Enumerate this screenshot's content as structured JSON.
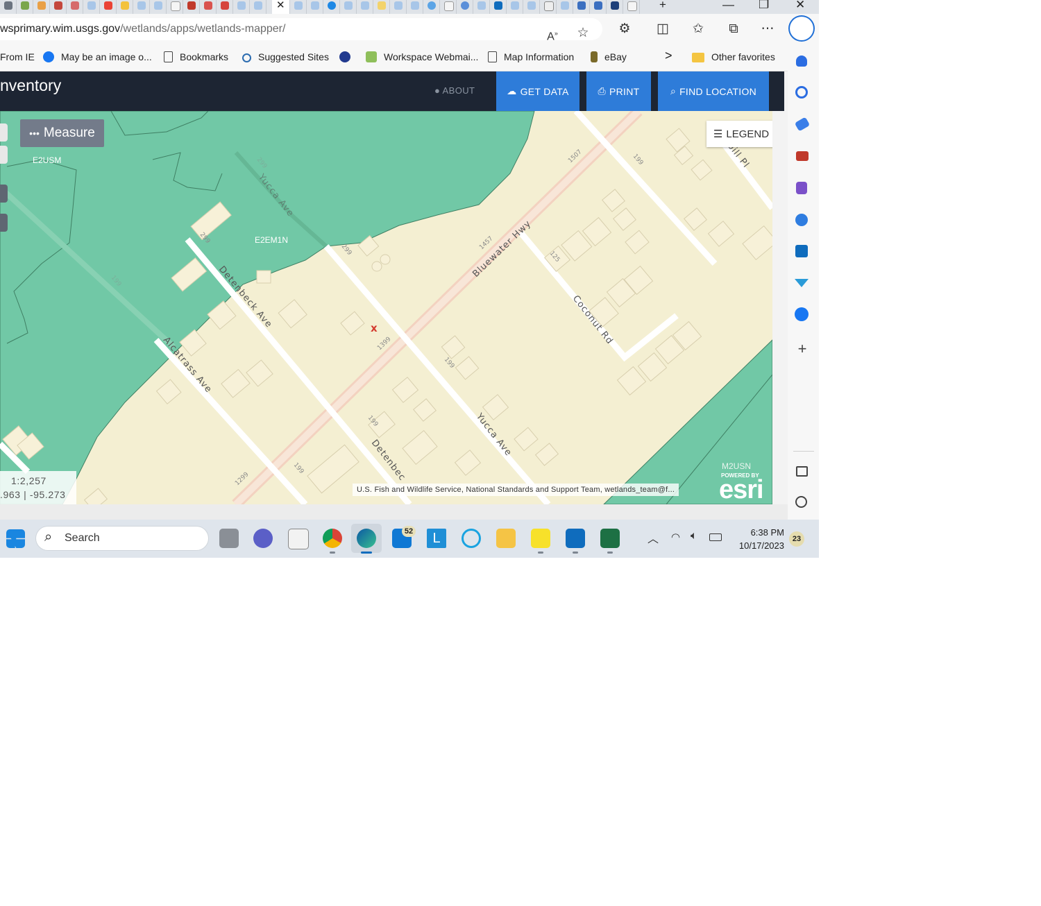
{
  "browser": {
    "url_host": "wsprimary.wim.usgs.gov",
    "url_path": "/wetlands/apps/wetlands-mapper/",
    "tab_close_glyph": "✕",
    "new_tab_glyph": "+",
    "window_controls": [
      "—",
      "❐",
      "✕"
    ]
  },
  "favorites": [
    {
      "label": "From IE",
      "icon": "none"
    },
    {
      "label": "May be an image o...",
      "icon": "facebook-icon"
    },
    {
      "label": "Bookmarks",
      "icon": "page-icon"
    },
    {
      "label": "Suggested Sites",
      "icon": "search-icon"
    },
    {
      "label": "Workspace Webmai...",
      "icon": "webmail-icon"
    },
    {
      "label": "Map Information",
      "icon": "page-icon"
    },
    {
      "label": "eBay",
      "icon": "ebay-icon"
    }
  ],
  "favorites_more": ">",
  "favorites_other": "Other favorites",
  "app": {
    "title": "nventory",
    "about": "ABOUT",
    "get_data": "GET DATA",
    "print": "PRINT",
    "find_location": "FIND LOCATION"
  },
  "map": {
    "measure": "Measure",
    "legend": "LEGEND",
    "scale": "1:2,257",
    "coords": ".963 | -95.273",
    "attribution": "U.S. Fish and Wildlife Service, National Standards and Support Team, wetlands_team@f...",
    "esri_powered": "POWERED BY",
    "esri_logo": "esri",
    "marker": "x",
    "labels": {
      "e2usm": "E2USM",
      "e2em1n": "E2EM1N",
      "m2usn": "M2USN"
    },
    "streets": {
      "yucca_upper": "Yucca Ave",
      "yucca_lower": "Yucca Ave",
      "bluewater": "Bluewater Hwy",
      "coconut": "Coconut Rd",
      "detenbeck_upper": "Detenbeck Ave",
      "detenbeck_lower": "Detenbec",
      "alcatrass": "Alcatrass Ave",
      "bill": "bill Pl"
    },
    "house_numbers": [
      "1507",
      "1457",
      "1399",
      "1299",
      "199",
      "125",
      "199",
      "199",
      "199",
      "299",
      "299",
      "299",
      "199"
    ]
  },
  "taskbar": {
    "search": "Search",
    "mail_badge": "52",
    "time": "6:38 PM",
    "date": "10/17/2023",
    "notif_badge": "23"
  },
  "colors": {
    "wetland": "#71c8a6",
    "wetland_dark": "#4aa57e",
    "land": "#f4efd2",
    "road": "#ffffff",
    "accent_button": "#2e7cd9",
    "header": "#1d2533"
  }
}
